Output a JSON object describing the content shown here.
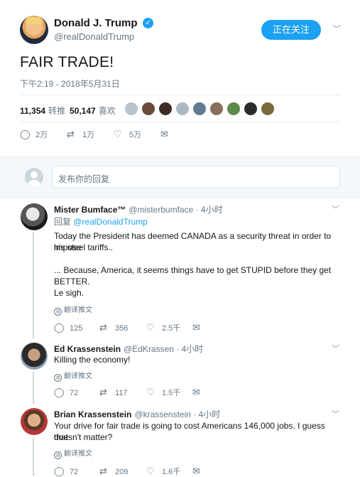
{
  "main_tweet": {
    "display_name": "Donald J. Trump",
    "handle": "@realDonaldTrump",
    "follow_label": "正在关注",
    "text": "FAIR TRADE!",
    "timestamp": "下午2:19 - 2018年5月31日",
    "retweets_count": "11,354",
    "retweets_label": "转推",
    "likes_count": "50,147",
    "likes_label": "喜欢",
    "actions": {
      "replies": "2万",
      "retweets": "1万",
      "likes": "5万"
    }
  },
  "reply_box": {
    "placeholder": "发布你的回复"
  },
  "replies": [
    {
      "display_name": "Mister Bumface™",
      "handle": "@misterbumface · 4小时",
      "reply_to_label": "回复",
      "reply_to_handle": "@realDonaldTrump",
      "lines": [
        "Today the President has deemed CANADA as a security threat in order to impose",
        "his steel tariffs..",
        "... Because, America, it seems things have to get STUPID before they get BETTER.",
        "Le sigh."
      ],
      "translate_label": "翻译推文",
      "replies": "125",
      "retweets": "356",
      "likes": "2.5千"
    },
    {
      "display_name": "Ed Krassenstein",
      "handle": "@EdKrassen · 4小时",
      "lines": [
        "Killing the economy!"
      ],
      "translate_label": "翻译推文",
      "replies": "72",
      "retweets": "117",
      "likes": "1.5千"
    },
    {
      "display_name": "Brian Krassenstein",
      "handle": "@krassenstein · 4小时",
      "lines": [
        "Your drive for fair trade is going to cost Americans 146,000 jobs. I guess that",
        "doesn't matter?"
      ],
      "translate_label": "翻译推文",
      "replies": "72",
      "retweets": "209",
      "likes": "1.6千"
    }
  ],
  "colors": {
    "accent": "#1da1f2",
    "muted": "#657786",
    "border": "#e6ecf0"
  }
}
